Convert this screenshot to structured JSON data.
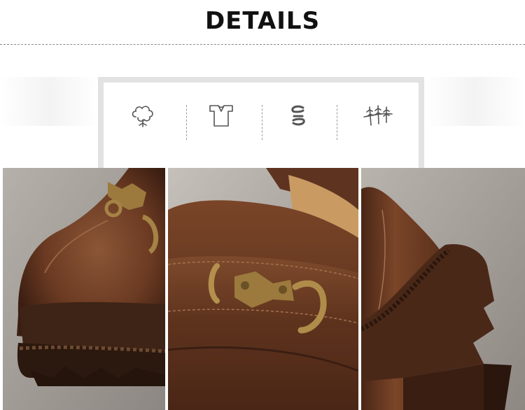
{
  "heading": {
    "text": "DETAILS"
  },
  "feature_icons": [
    {
      "icon": "cotton-flower-icon"
    },
    {
      "icon": "t-shirt-icon"
    },
    {
      "icon": "stretch-wave-icon"
    },
    {
      "icon": "wheat-grass-icon"
    }
  ],
  "photos": [
    {
      "subject": "toe-and-sole-closeup"
    },
    {
      "subject": "metal-buckle-closeup"
    },
    {
      "subject": "heel-closeup"
    }
  ],
  "colors": {
    "leather": "#6b3a22",
    "leather_dark": "#3b1e12",
    "leather_light": "#8a5636",
    "hardware": "#9c7a3e",
    "background_photo": "#a09a94"
  }
}
